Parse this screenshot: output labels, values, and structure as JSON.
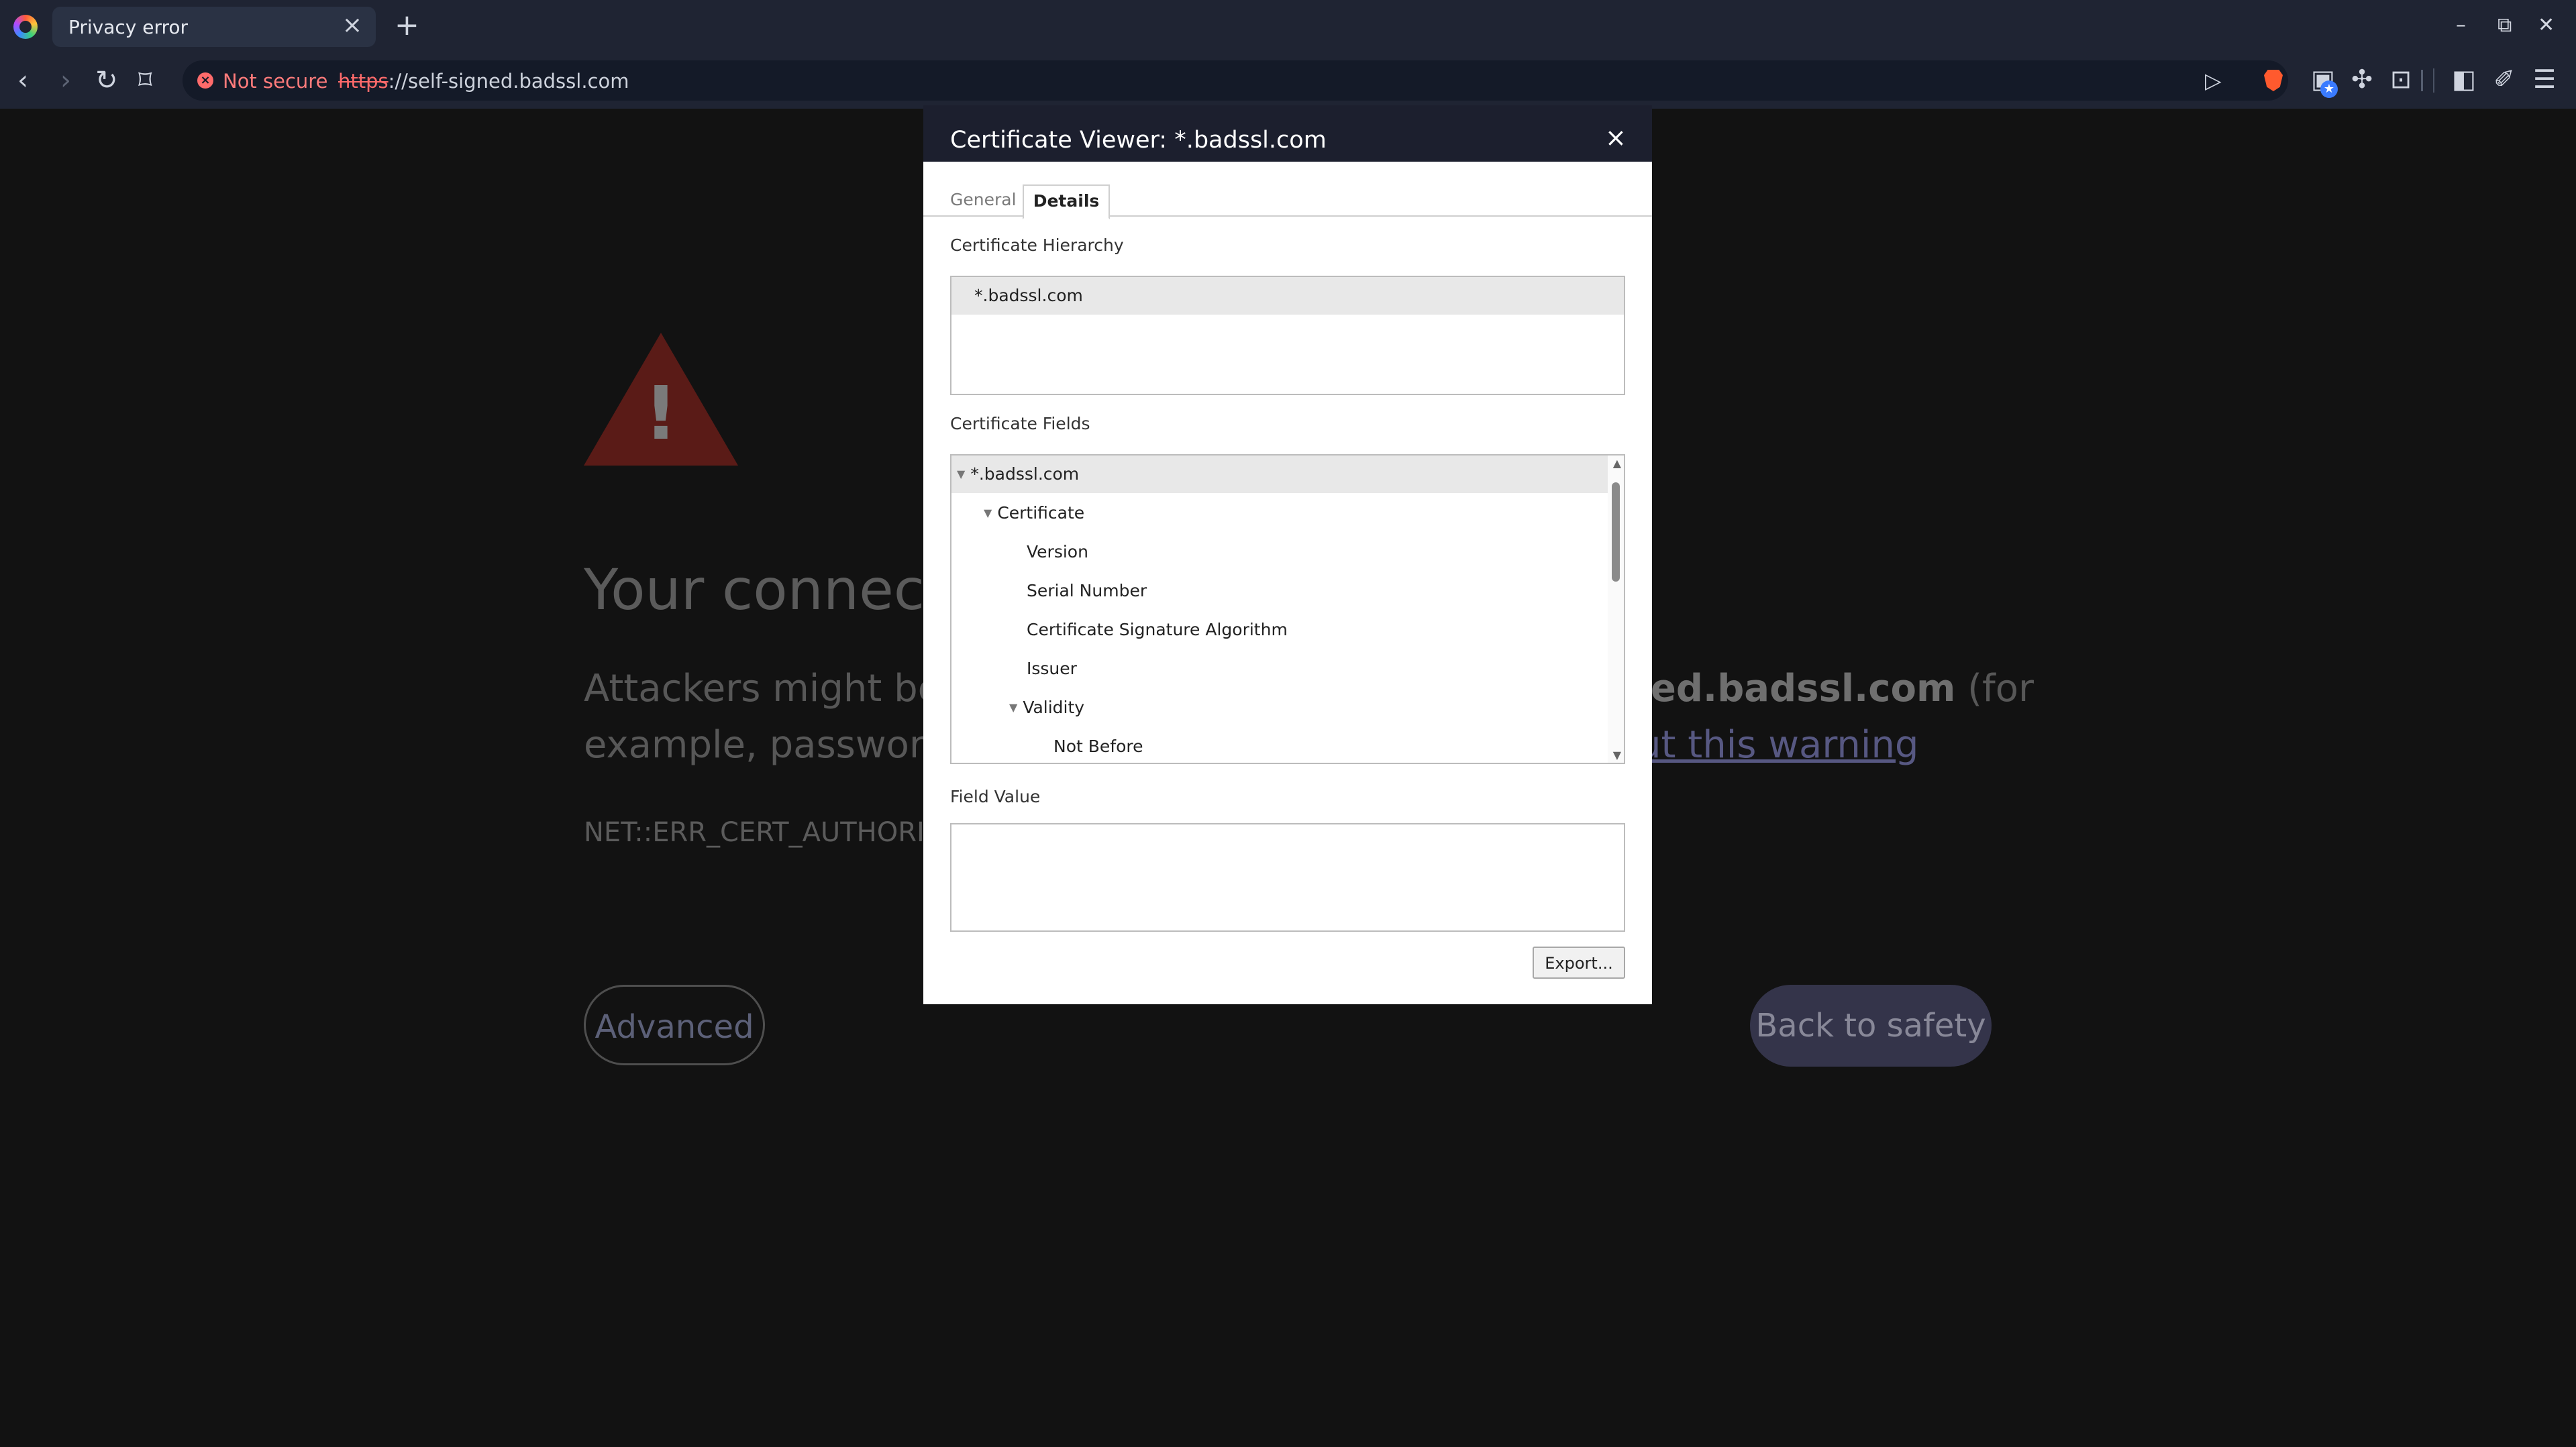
{
  "browser": {
    "tab": {
      "title": "Privacy error",
      "close_glyph": "×"
    },
    "new_tab_glyph": "+",
    "window_controls": {
      "minimize": "–",
      "maximize": "⧉",
      "close": "✕"
    },
    "toolbar_glyphs": {
      "back": "‹",
      "forward": "›",
      "reload": "↻",
      "bookmark": "⌑"
    },
    "security_chip": {
      "icon": "x-circle-icon",
      "label": "Not secure"
    },
    "url": {
      "scheme": "https",
      "rest": "://self-signed.badssl.com"
    },
    "omnibox_icons": {
      "send": "▷",
      "shield": "brave-shield-icon"
    },
    "accent_color": "#ff6b6b"
  },
  "page": {
    "heading": "Your connect",
    "para_line1_left": "Attackers might be t",
    "para_line1_bold": "ned.badssl.com",
    "para_line1_tail": " (for",
    "para_line2_left": "example, passwords",
    "para_line2_link": "ut this warning",
    "error_code": "NET::ERR_CERT_AUTHORI",
    "advanced_button": "Advanced",
    "back_button": "Back to safety",
    "warning_glyph": "!"
  },
  "dialog": {
    "title": "Certificate Viewer: *.badssl.com",
    "close_glyph": "×",
    "tabs": [
      {
        "label": "General",
        "active": false
      },
      {
        "label": "Details",
        "active": true
      }
    ],
    "hierarchy_label": "Certificate Hierarchy",
    "hierarchy_items": [
      "*.badssl.com"
    ],
    "fields_label": "Certificate Fields",
    "fields": [
      {
        "label": "*.badssl.com",
        "expanded": true,
        "selected": true
      },
      {
        "label": "Certificate",
        "expanded": true
      },
      {
        "label": "Version"
      },
      {
        "label": "Serial Number"
      },
      {
        "label": "Certificate Signature Algorithm"
      },
      {
        "label": "Issuer"
      },
      {
        "label": "Validity",
        "expanded": true
      },
      {
        "label": "Not Before"
      }
    ],
    "field_value_label": "Field Value",
    "field_value": "",
    "export_button": "Export..."
  }
}
